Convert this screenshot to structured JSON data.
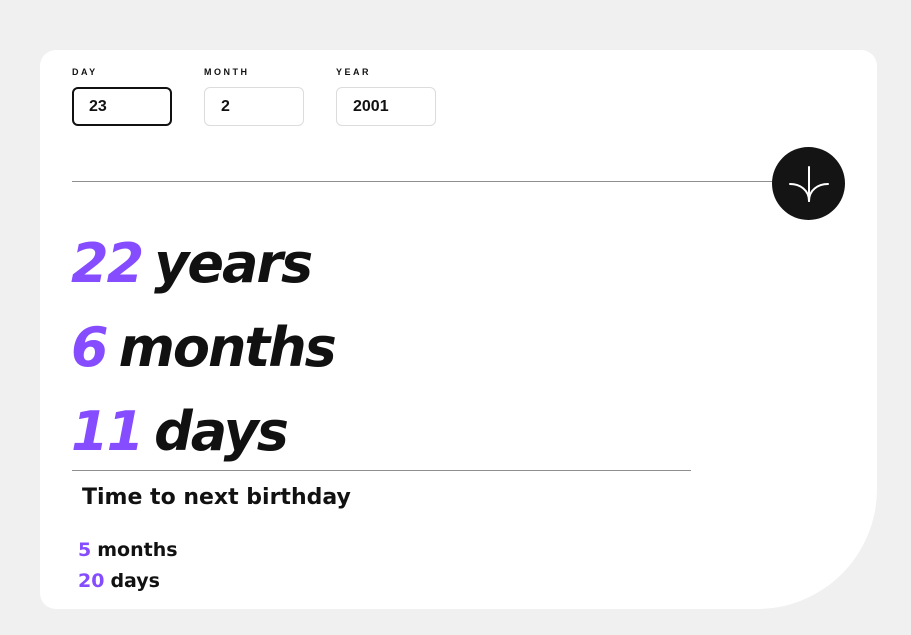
{
  "inputs": {
    "day": {
      "label": "DAY",
      "value": "23"
    },
    "month": {
      "label": "MONTH",
      "value": "2"
    },
    "year": {
      "label": "YEAR",
      "value": "2001"
    }
  },
  "submit": {
    "icon": "arrow-down-icon"
  },
  "age": {
    "years": {
      "value": "22",
      "unit": "years"
    },
    "months": {
      "value": "6",
      "unit": "months"
    },
    "days": {
      "value": "11",
      "unit": "days"
    }
  },
  "next_birthday": {
    "title": "Time to next birthday",
    "months": {
      "value": "5",
      "unit": "months"
    },
    "days": {
      "value": "20",
      "unit": "days"
    }
  },
  "colors": {
    "accent": "#854dff",
    "text": "#111111",
    "button": "#141414",
    "background": "#f0f0f0",
    "card": "#ffffff"
  }
}
